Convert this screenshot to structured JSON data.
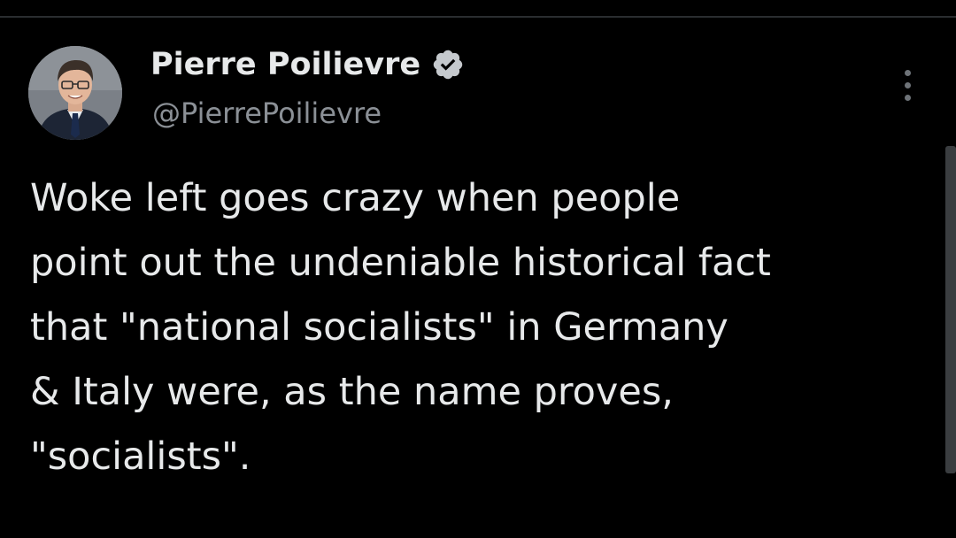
{
  "tweet": {
    "author": {
      "display_name": "Pierre Poilievre",
      "handle": "@PierrePoilievre",
      "verified": true,
      "verified_badge_icon": "verified-badge-icon"
    },
    "more_options_icon": "more-vertical-icon",
    "text_lines": [
      "Woke left goes crazy when people",
      "point out the undeniable historical fact",
      "that \"national socialists\" in Germany",
      "& Italy were, as the name proves,",
      "\"socialists\"."
    ]
  },
  "colors": {
    "background": "#000000",
    "primary_text": "#e7e9ea",
    "secondary_text": "#8b9096",
    "badge": "#c5c9cd",
    "divider": "#2a2d30",
    "scrollbar": "#3a3d40"
  }
}
